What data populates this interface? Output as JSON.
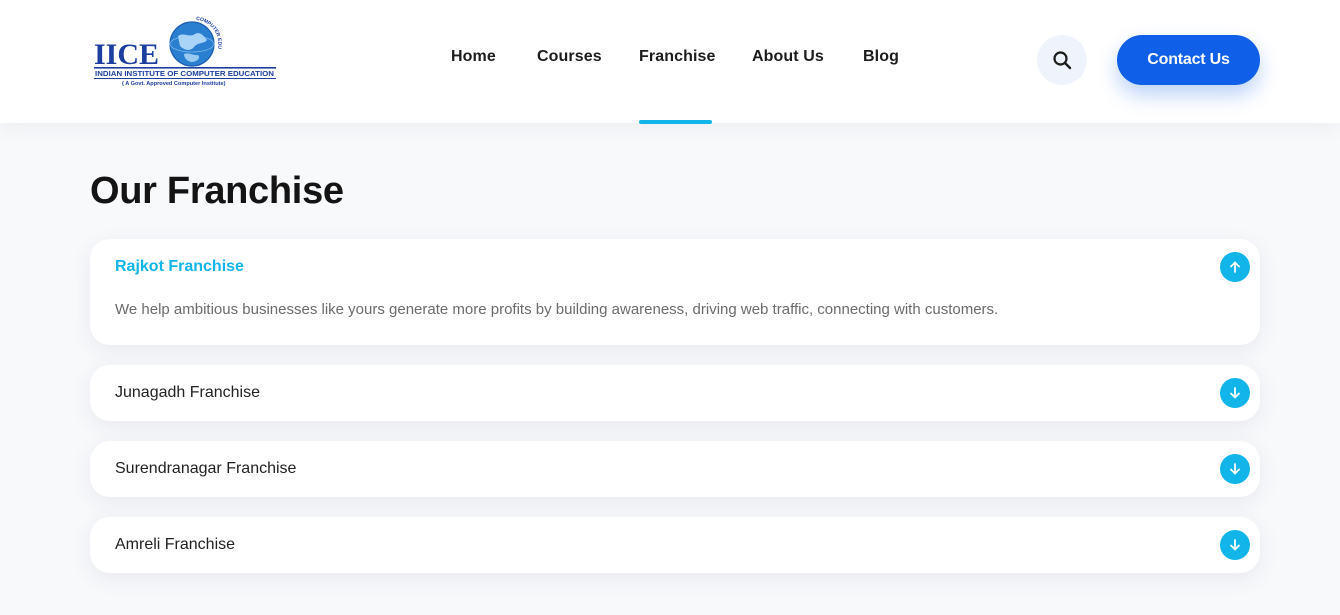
{
  "brand": {
    "logo_name": "IICE",
    "logo_line1": "INDIAN INSTITUTE OF COMPUTER EDUCATION",
    "logo_line2": "( A Govt. Approved Computer Institute)",
    "logo_arc": "COMPUTER EDUCATION",
    "colors": {
      "navy": "#1b3ea0",
      "globe": "#2a7fd0"
    }
  },
  "nav": {
    "items": [
      {
        "label": "Home"
      },
      {
        "label": "Courses"
      },
      {
        "label": "Franchise",
        "active": true
      },
      {
        "label": "About Us"
      },
      {
        "label": "Blog"
      }
    ]
  },
  "header_actions": {
    "search_icon": "search-icon",
    "contact_label": "Contact Us"
  },
  "page": {
    "title": "Our Franchise"
  },
  "accordion": {
    "items": [
      {
        "title": "Rajkot Franchise",
        "expanded": true,
        "icon": "arrow-up-icon",
        "body": "We help ambitious businesses like yours generate more profits by building awareness, driving web traffic, connecting with customers."
      },
      {
        "title": "Junagadh Franchise",
        "expanded": false,
        "icon": "arrow-down-icon"
      },
      {
        "title": "Surendranagar Franchise",
        "expanded": false,
        "icon": "arrow-down-icon"
      },
      {
        "title": "Amreli Franchise",
        "expanded": false,
        "icon": "arrow-down-icon"
      }
    ]
  },
  "colors": {
    "accent": "#12b5ea",
    "primary_button": "#0f5fe8",
    "background": "#f8f9fb"
  }
}
